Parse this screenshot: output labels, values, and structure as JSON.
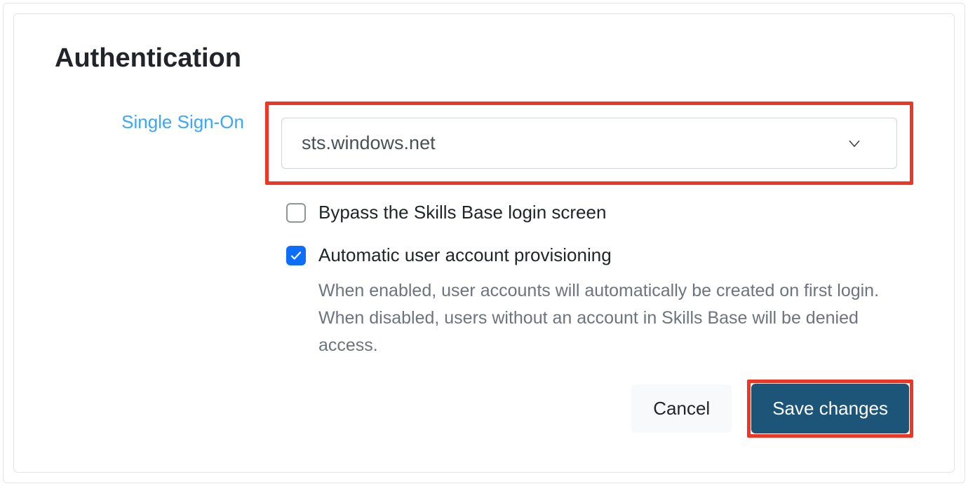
{
  "title": "Authentication",
  "sso": {
    "label": "Single Sign-On",
    "selected": "sts.windows.net"
  },
  "bypass": {
    "label": "Bypass the Skills Base login screen",
    "checked": false
  },
  "provisioning": {
    "label": "Automatic user account provisioning",
    "checked": true,
    "help": "When enabled, user accounts will automatically be created on first login. When disabled, users without an account in Skills Base will be denied access."
  },
  "buttons": {
    "cancel": "Cancel",
    "save": "Save changes"
  }
}
